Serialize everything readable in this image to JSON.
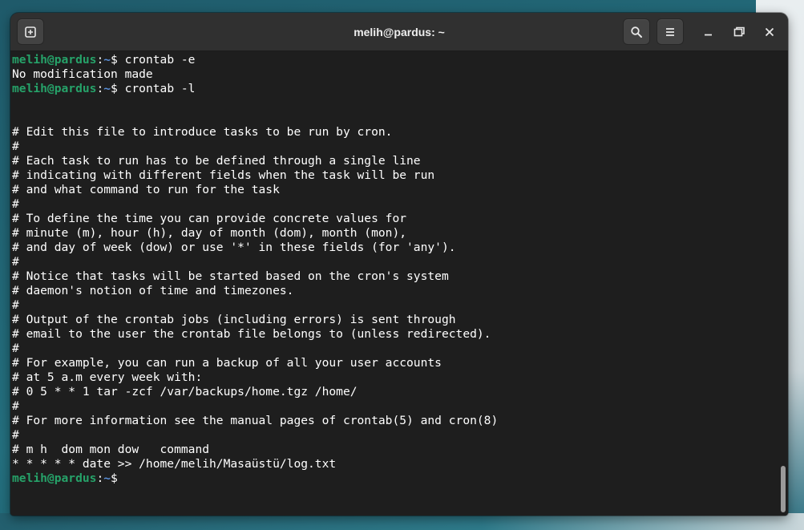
{
  "window": {
    "title": "melih@pardus: ~"
  },
  "icons": {
    "new_tab": "new-tab-icon",
    "search": "search-icon",
    "menu": "hamburger-menu-icon",
    "minimize": "minimize-icon",
    "maximize": "maximize-icon",
    "close": "close-icon"
  },
  "colors": {
    "prompt_user": "#26a269",
    "prompt_path": "#5a8fd8",
    "text": "#ffffff",
    "background": "#1e1e1e",
    "headerbar": "#303030"
  },
  "prompt": {
    "user_host": "melih@pardus",
    "colon": ":",
    "path": "~",
    "symbol": "$ "
  },
  "terminal": {
    "lines": [
      {
        "type": "prompt",
        "command": "crontab -e"
      },
      {
        "type": "output",
        "text": "No modification made"
      },
      {
        "type": "prompt",
        "command": "crontab -l"
      },
      {
        "type": "output",
        "text": ""
      },
      {
        "type": "output",
        "text": ""
      },
      {
        "type": "output",
        "text": "# Edit this file to introduce tasks to be run by cron."
      },
      {
        "type": "output",
        "text": "#"
      },
      {
        "type": "output",
        "text": "# Each task to run has to be defined through a single line"
      },
      {
        "type": "output",
        "text": "# indicating with different fields when the task will be run"
      },
      {
        "type": "output",
        "text": "# and what command to run for the task"
      },
      {
        "type": "output",
        "text": "#"
      },
      {
        "type": "output",
        "text": "# To define the time you can provide concrete values for"
      },
      {
        "type": "output",
        "text": "# minute (m), hour (h), day of month (dom), month (mon),"
      },
      {
        "type": "output",
        "text": "# and day of week (dow) or use '*' in these fields (for 'any')."
      },
      {
        "type": "output",
        "text": "#"
      },
      {
        "type": "output",
        "text": "# Notice that tasks will be started based on the cron's system"
      },
      {
        "type": "output",
        "text": "# daemon's notion of time and timezones."
      },
      {
        "type": "output",
        "text": "#"
      },
      {
        "type": "output",
        "text": "# Output of the crontab jobs (including errors) is sent through"
      },
      {
        "type": "output",
        "text": "# email to the user the crontab file belongs to (unless redirected)."
      },
      {
        "type": "output",
        "text": "#"
      },
      {
        "type": "output",
        "text": "# For example, you can run a backup of all your user accounts"
      },
      {
        "type": "output",
        "text": "# at 5 a.m every week with:"
      },
      {
        "type": "output",
        "text": "# 0 5 * * 1 tar -zcf /var/backups/home.tgz /home/"
      },
      {
        "type": "output",
        "text": "#"
      },
      {
        "type": "output",
        "text": "# For more information see the manual pages of crontab(5) and cron(8)"
      },
      {
        "type": "output",
        "text": "#"
      },
      {
        "type": "output",
        "text": "# m h  dom mon dow   command"
      },
      {
        "type": "output",
        "text": "* * * * * date >> /home/melih/Masaüstü/log.txt"
      },
      {
        "type": "prompt",
        "command": ""
      }
    ]
  }
}
